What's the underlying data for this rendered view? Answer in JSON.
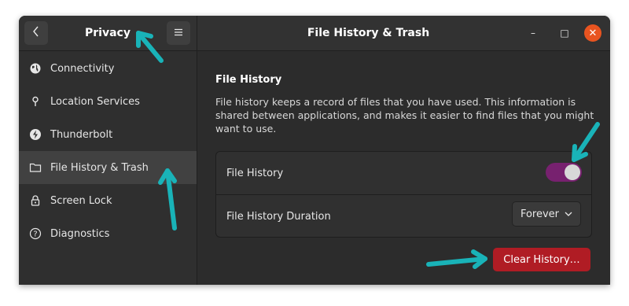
{
  "sidebar": {
    "back_icon": "chevron-left-icon",
    "title": "Privacy",
    "menu_icon": "hamburger-menu-icon",
    "items": [
      {
        "label": "Connectivity",
        "icon": "globe-icon"
      },
      {
        "label": "Location Services",
        "icon": "location-pin-icon"
      },
      {
        "label": "Thunderbolt",
        "icon": "thunderbolt-icon"
      },
      {
        "label": "File History & Trash",
        "icon": "folder-icon",
        "selected": true
      },
      {
        "label": "Screen Lock",
        "icon": "lock-icon"
      },
      {
        "label": "Diagnostics",
        "icon": "help-circle-icon"
      }
    ]
  },
  "main": {
    "title": "File History & Trash",
    "section_title": "File History",
    "description": "File history keeps a record of files that you have used. This information is shared between applications, and makes it easier to find files that you might want to use.",
    "file_history_label": "File History",
    "file_history_enabled": true,
    "duration_label": "File History Duration",
    "duration_value": "Forever",
    "clear_button": "Clear History…"
  },
  "window_controls": {
    "minimize": "–",
    "maximize": "□",
    "close": "✕"
  },
  "colors": {
    "accent_toggle": "#77216f",
    "destructive": "#b01c24",
    "close_button": "#e95420",
    "annotation_arrow": "#19b3b8"
  }
}
